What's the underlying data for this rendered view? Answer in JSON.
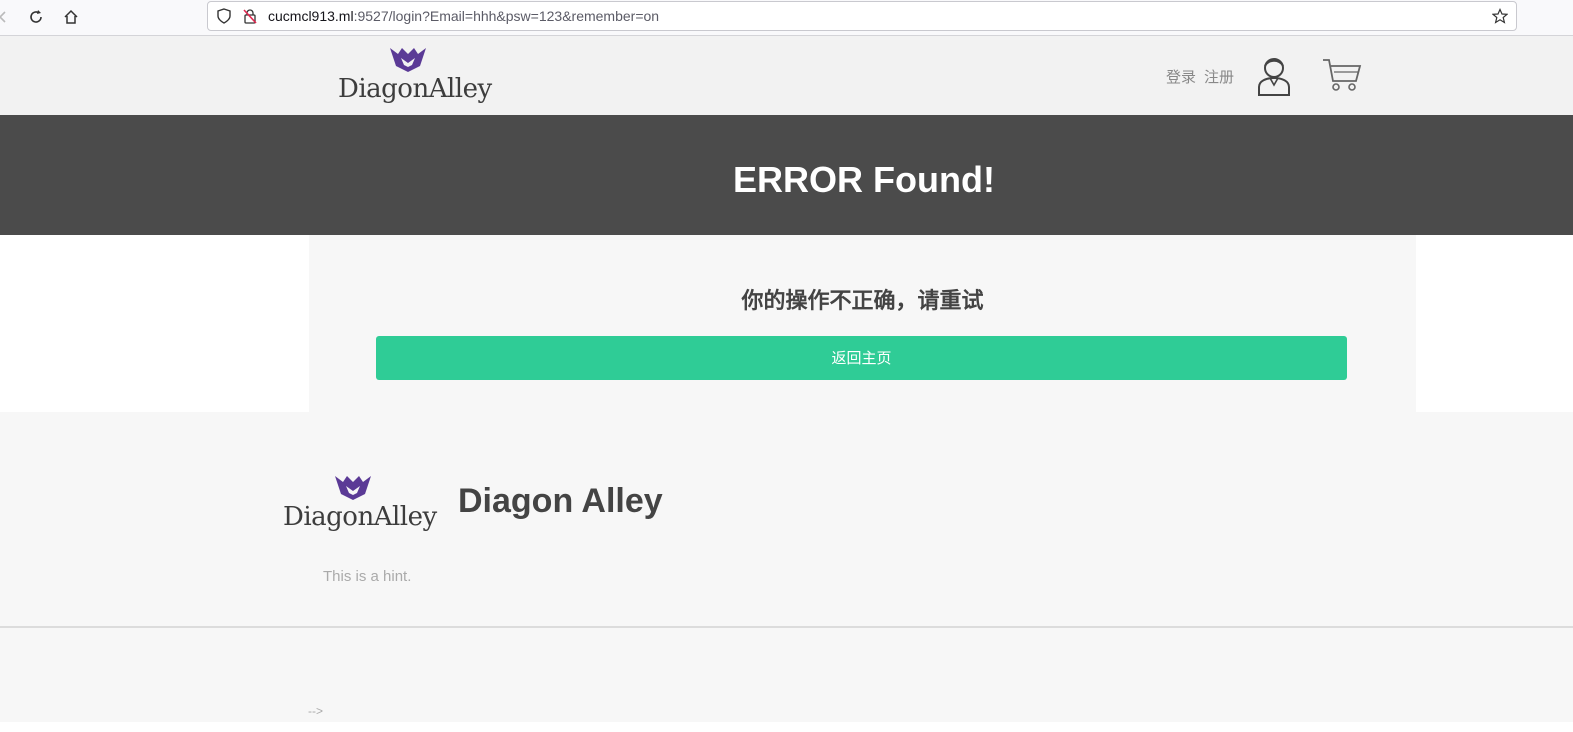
{
  "browser": {
    "url_host": "cucmcl913.ml",
    "url_path": ":9527/login?Email=hhh&psw=123&remember=on",
    "icons": [
      "back-arrow-icon",
      "reload-icon",
      "home-icon",
      "shield-icon",
      "insecure-lock-icon",
      "star-icon"
    ]
  },
  "header": {
    "logo_text": "DiagonAlley",
    "login_label": "登录",
    "register_label": "注册",
    "icons": [
      "user-icon",
      "cart-icon"
    ]
  },
  "banner": {
    "title": "ERROR Found!"
  },
  "message": {
    "text": "你的操作不正确，请重试",
    "button_label": "返回主页"
  },
  "footer": {
    "logo_text": "DiagonAlley",
    "title": "Diagon Alley",
    "hint": "This is a hint.",
    "comment_text": "-->"
  },
  "colors": {
    "logo_purple": "#5b3a96",
    "banner_bg": "#4b4b4b",
    "button_green": "#2fcc96"
  }
}
